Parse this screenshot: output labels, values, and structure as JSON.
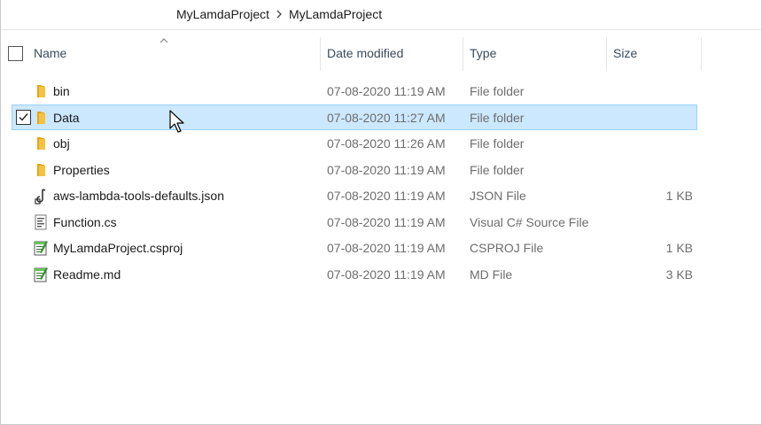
{
  "breadcrumb": [
    "MyLamdaProject",
    "MyLamdaProject"
  ],
  "columns": {
    "name": "Name",
    "date": "Date modified",
    "type": "Type",
    "size": "Size"
  },
  "files": [
    {
      "name": "bin",
      "date": "07-08-2020 11:19 AM",
      "type": "File folder",
      "size": "",
      "icon": "folder-icon",
      "selected": false
    },
    {
      "name": "Data",
      "date": "07-08-2020 11:27 AM",
      "type": "File folder",
      "size": "",
      "icon": "folder-icon",
      "selected": true
    },
    {
      "name": "obj",
      "date": "07-08-2020 11:26 AM",
      "type": "File folder",
      "size": "",
      "icon": "folder-icon",
      "selected": false
    },
    {
      "name": "Properties",
      "date": "07-08-2020 11:19 AM",
      "type": "File folder",
      "size": "",
      "icon": "folder-icon",
      "selected": false
    },
    {
      "name": "aws-lambda-tools-defaults.json",
      "date": "07-08-2020 11:19 AM",
      "type": "JSON File",
      "size": "1 KB",
      "icon": "json-file-icon",
      "selected": false
    },
    {
      "name": "Function.cs",
      "date": "07-08-2020 11:19 AM",
      "type": "Visual C# Source File",
      "size": "",
      "icon": "cs-file-icon",
      "selected": false
    },
    {
      "name": "MyLamdaProject.csproj",
      "date": "07-08-2020 11:19 AM",
      "type": "CSPROJ File",
      "size": "1 KB",
      "icon": "notepad-file-icon",
      "selected": false
    },
    {
      "name": "Readme.md",
      "date": "07-08-2020 11:19 AM",
      "type": "MD File",
      "size": "3 KB",
      "icon": "notepad-file-icon",
      "selected": false
    }
  ],
  "colors": {
    "selection": "#cce8ff",
    "selection_border": "#99d1ff",
    "folder": "#f5c242"
  }
}
